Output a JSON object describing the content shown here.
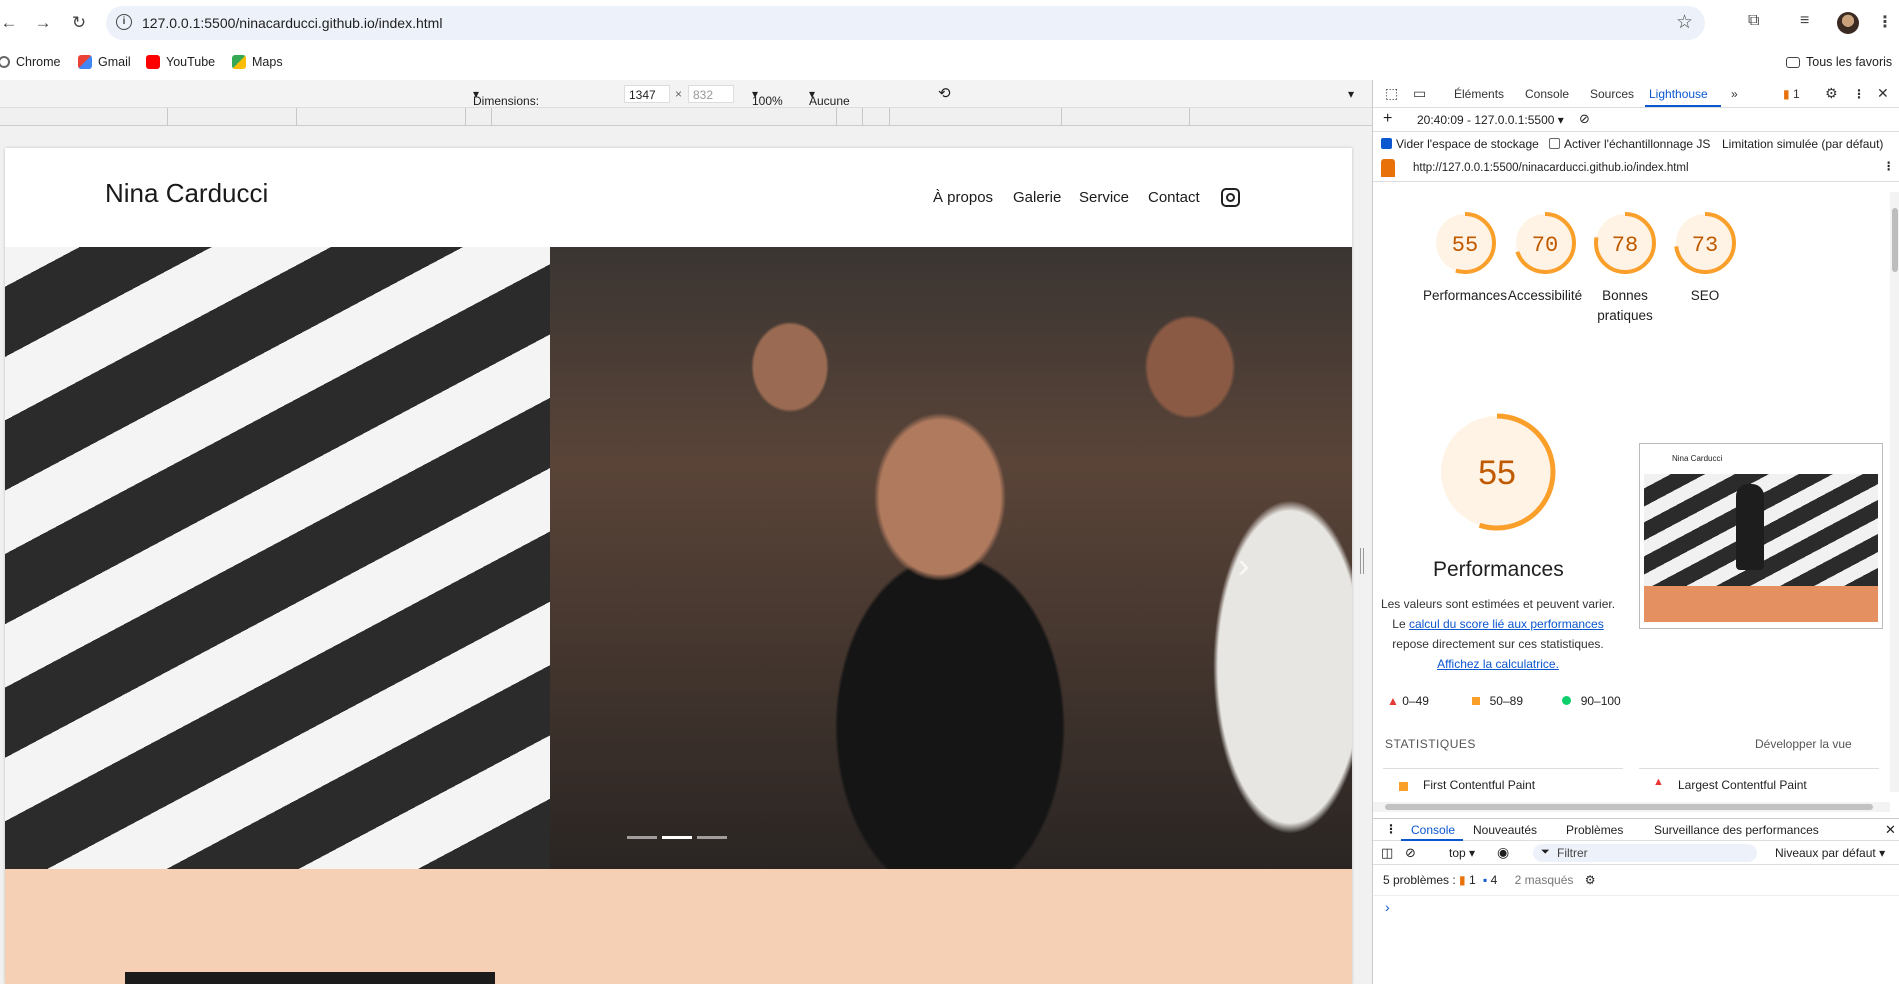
{
  "browser": {
    "url": "127.0.0.1:5500/ninacarducci.github.io/index.html",
    "bookmarks": [
      "Chrome",
      "Gmail",
      "YouTube",
      "Maps"
    ],
    "all_bookmarks": "Tous les favoris"
  },
  "device_toolbar": {
    "dimensions_label": "Dimensions: Réactivité",
    "width": "1347",
    "times": "×",
    "height": "832",
    "zoom": "100%",
    "throttle": "Aucune limitation"
  },
  "site": {
    "brand": "Nina Carducci",
    "nav": [
      "À propos",
      "Galerie",
      "Service",
      "Contact"
    ],
    "next_arrow": "›"
  },
  "devtools": {
    "tabs": [
      "Éléments",
      "Console",
      "Sources",
      "Lighthouse"
    ],
    "issues_count": "1",
    "report_select": "20:40:09 - 127.0.0.1:5500",
    "clear_storage": "Vider l'espace de stockage",
    "js_sampling": "Activer l'échantillonnage JS",
    "throttling": "Limitation simulée (par défaut)",
    "report_url": "http://127.0.0.1:5500/ninacarducci.github.io/index.html",
    "scores": [
      {
        "value": 55,
        "label": "Performances",
        "color": "#fa9f2a"
      },
      {
        "value": 70,
        "label": "Accessibilité",
        "color": "#fa9f2a"
      },
      {
        "value": 78,
        "label": "Bonnes pratiques",
        "color": "#fa9f2a"
      },
      {
        "value": 73,
        "label": "SEO",
        "color": "#fa9f2a"
      }
    ],
    "big_score": {
      "value": 55,
      "label": "Performances"
    },
    "desc_1": "Les valeurs sont estimées et peuvent varier. Le",
    "desc_link_1": "calcul du score lié aux performances",
    "desc_2": "repose directement sur ces statistiques.",
    "desc_link_2": "Affichez la calculatrice.",
    "legend": [
      "0–49",
      "50–89",
      "90–100"
    ],
    "stats_title": "STATISTIQUES",
    "expand_view": "Développer la vue",
    "metrics": [
      "First Contentful Paint",
      "Largest Contentful Paint"
    ],
    "thumbnail_brand": "Nina Carducci"
  },
  "drawer": {
    "tabs": [
      "Console",
      "Nouveautés",
      "Problèmes",
      "Surveillance des performances"
    ],
    "context": "top",
    "filter_placeholder": "Filtrer",
    "levels": "Niveaux par défaut",
    "problems_label": "5 problèmes :",
    "problems_warn": "1",
    "problems_info": "4",
    "hidden": "2 masqués",
    "prompt": "›"
  }
}
